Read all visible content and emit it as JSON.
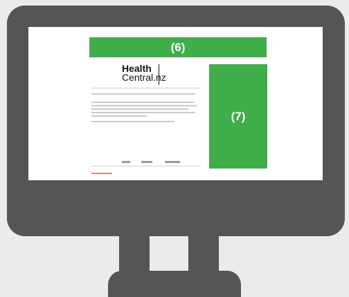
{
  "ads": {
    "banner_label": "(6)",
    "side_label": "(7)",
    "color": "#3fae49"
  },
  "article": {
    "logo_line1": "Health",
    "logo_line2": "Central",
    "logo_suffix": ".nz"
  },
  "colors": {
    "monitor": "#555555",
    "background": "#ebebeb",
    "screen": "#ffffff"
  }
}
